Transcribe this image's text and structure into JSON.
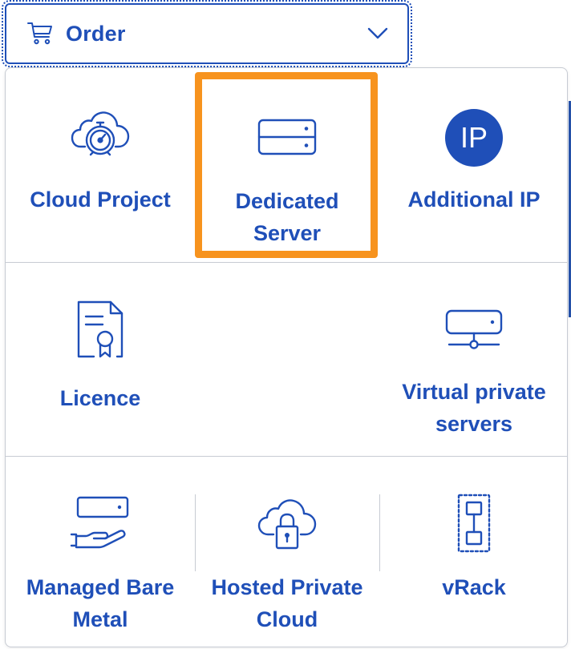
{
  "order_button": {
    "label": "Order",
    "icon": "cart-icon",
    "dropdown_icon": "chevron-down-icon"
  },
  "menu": {
    "items": [
      {
        "label": "Cloud Project",
        "icon": "cloud-gauge-icon"
      },
      {
        "label": "Dedicated Server",
        "icon": "server-icon",
        "highlighted": true
      },
      {
        "label": "Additional IP",
        "icon": "ip-badge-icon"
      },
      {
        "label": "Licence",
        "icon": "certificate-icon"
      },
      {
        "label": "Virtual private servers",
        "icon": "vps-network-icon"
      },
      {
        "label": "Managed Bare Metal",
        "icon": "server-hand-icon"
      },
      {
        "label": "Hosted Private Cloud",
        "icon": "cloud-lock-icon"
      },
      {
        "label": "vRack",
        "icon": "vrack-icon"
      }
    ]
  },
  "colors": {
    "accent": "#1f4fb8",
    "highlight": "#f7931e",
    "divider": "#c7cbd3",
    "background": "#ffffff"
  }
}
